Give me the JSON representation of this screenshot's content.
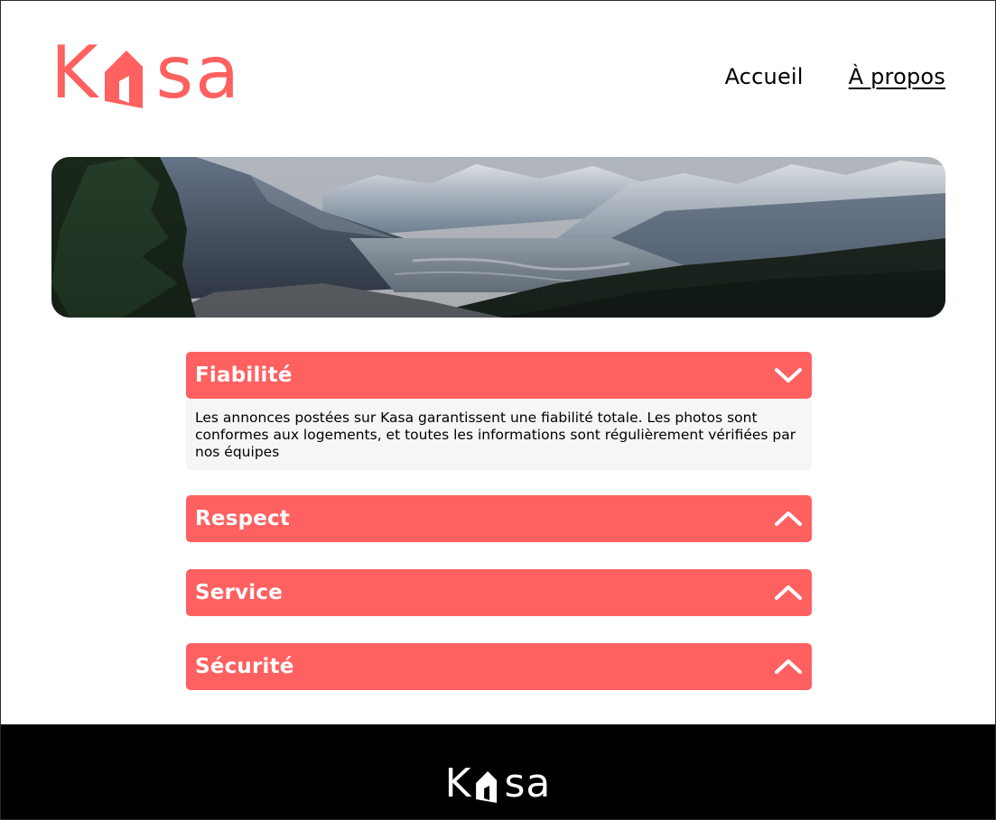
{
  "brand": {
    "logo_left": "K",
    "logo_right": "sa",
    "accent_color": "#ff6060"
  },
  "nav": {
    "items": [
      {
        "label": "Accueil",
        "active": false
      },
      {
        "label": "À propos",
        "active": true
      }
    ]
  },
  "accordions": [
    {
      "title": "Fiabilité",
      "expanded": true,
      "icon": "chevron-down-icon",
      "content": "Les annonces postées sur Kasa garantissent une fiabilité totale. Les photos sont conformes aux logements, et toutes les informations sont régulièrement vérifiées par nos équipes"
    },
    {
      "title": "Respect",
      "expanded": false,
      "icon": "chevron-up-icon"
    },
    {
      "title": "Service",
      "expanded": false,
      "icon": "chevron-up-icon"
    },
    {
      "title": "Sécurité",
      "expanded": false,
      "icon": "chevron-up-icon"
    }
  ],
  "footer": {
    "logo_left": "K",
    "logo_right": "sa",
    "background": "#000000"
  }
}
